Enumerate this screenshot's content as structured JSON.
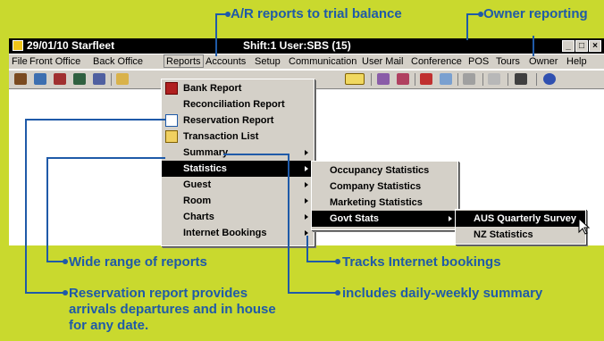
{
  "callouts": {
    "ar_reports": "A/R reports to trial balance",
    "owner": "Owner reporting",
    "wide_range": "Wide range of reports",
    "reservation": "Reservation report provides arrivals departures and in house for any date.",
    "internet": "Tracks Internet bookings",
    "summary": "includes daily-weekly summary"
  },
  "window": {
    "title": "29/01/10  Starfleet",
    "status": "Shift:1   User:SBS (15)",
    "minimize": "_",
    "maximize": "□",
    "close": "×"
  },
  "menubar": [
    "File",
    "Front Office",
    "Back Office",
    "Reports",
    "Accounts",
    "Setup",
    "Communication",
    "User Mail",
    "Conference",
    "POS",
    "Tours",
    "Owner",
    "Help"
  ],
  "reports_menu": [
    {
      "label": "Bank Report",
      "icon": "book-icon"
    },
    {
      "label": "Reconciliation Report",
      "icon": ""
    },
    {
      "label": "Reservation Report",
      "icon": "document-icon"
    },
    {
      "label": "Transaction List",
      "icon": "list-icon"
    },
    {
      "label": "Summary",
      "submenu": true
    },
    {
      "label": "Statistics",
      "submenu": true,
      "highlighted": true
    },
    {
      "label": "Guest",
      "submenu": true
    },
    {
      "label": "Room",
      "submenu": true
    },
    {
      "label": "Charts",
      "submenu": true
    },
    {
      "label": "Internet Bookings",
      "submenu": true
    }
  ],
  "statistics_menu": [
    {
      "label": "Occupancy Statistics"
    },
    {
      "label": "Company Statistics"
    },
    {
      "label": "Marketing Statistics"
    },
    {
      "label": "Govt Stats",
      "submenu": true,
      "highlighted": true
    }
  ],
  "govt_menu": [
    {
      "label": "AUS Quarterly Survey",
      "highlighted": true
    },
    {
      "label": "NZ Statistics"
    }
  ],
  "colors": {
    "background": "#c9d92e",
    "callout": "#1f5aa8",
    "menu_highlight": "#000000"
  }
}
